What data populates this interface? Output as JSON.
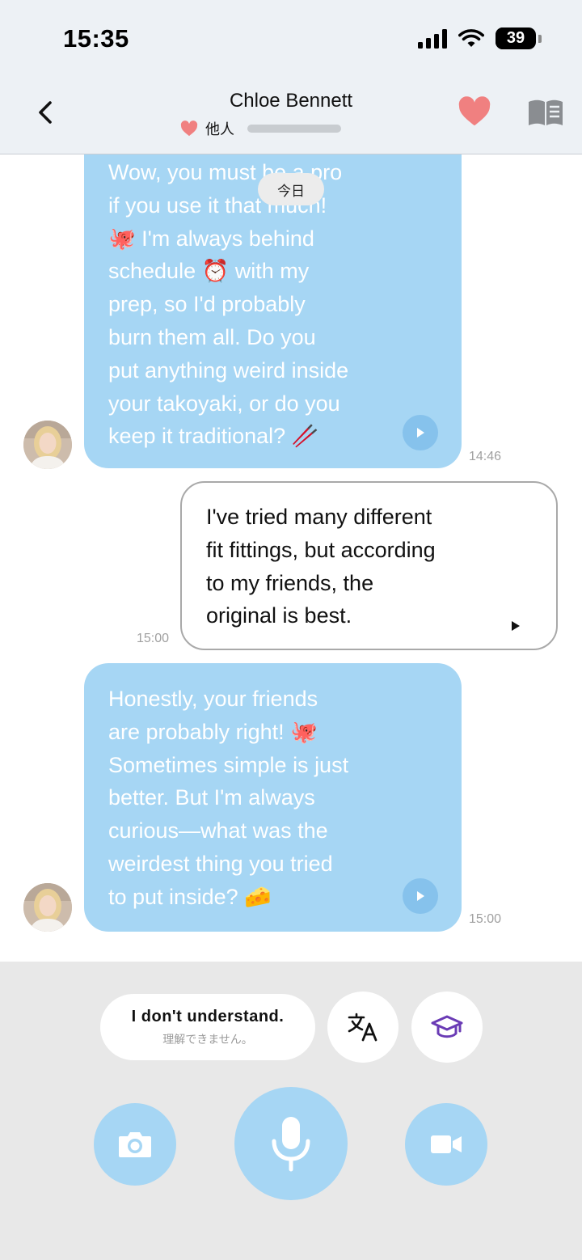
{
  "status_bar": {
    "time": "15:35",
    "battery": "39",
    "battery_level": 0.39
  },
  "header": {
    "back_icon": "chevron-left-icon",
    "name": "Chloe Bennett",
    "relation_label": "他人",
    "relation_progress": 0.0,
    "favorite_icon": "heart-icon",
    "book_icon": "book-icon"
  },
  "chat": {
    "date_separator": "今日",
    "messages": [
      {
        "sender": "contact",
        "lines": [
          "Wow, you must be a pro",
          "if you use it that much!",
          "🐙 I'm always behind",
          "schedule ⏰ with my",
          "prep, so I'd probably",
          "burn them all. Do you",
          "put anything weird inside",
          "your takoyaki, or do you",
          "keep it traditional? 🥢"
        ],
        "time": "14:46"
      },
      {
        "sender": "user",
        "lines": [
          "I've tried many different",
          "fit fittings, but according",
          "to my friends, the",
          "original is best."
        ],
        "time": "15:00"
      },
      {
        "sender": "contact",
        "lines": [
          "Honestly, your friends",
          "are probably right! 🐙",
          "Sometimes simple is just",
          "better. But I'm always",
          "curious—what was the",
          "weirdest thing you tried",
          "to put inside? 🧀"
        ],
        "time": "15:00"
      }
    ]
  },
  "panel": {
    "phrase_en": "I don't understand.",
    "phrase_ja": "理解できません。",
    "translate_icon": "translate-icon",
    "learn_icon": "graduation-cap-icon",
    "camera_icon": "camera-icon",
    "mic_icon": "microphone-icon",
    "video_icon": "video-camera-icon",
    "accent_color": "#a6d6f4",
    "learn_color": "#6a3bb5"
  }
}
